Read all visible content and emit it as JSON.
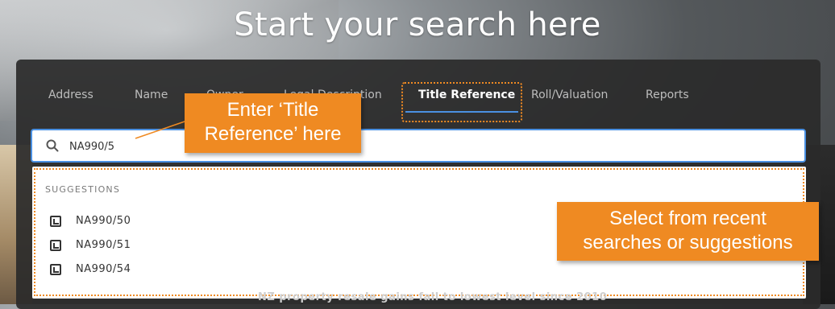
{
  "headline": "Start your search here",
  "tabs": [
    {
      "label": "Address"
    },
    {
      "label": "Name"
    },
    {
      "label": "Owner"
    },
    {
      "label": "Legal Description"
    },
    {
      "label": "Title Reference",
      "active": true
    },
    {
      "label": "Roll/Valuation"
    },
    {
      "label": "Reports"
    }
  ],
  "search": {
    "value": "NA990/5",
    "icon": "search-icon"
  },
  "suggestions": {
    "title": "SUGGESTIONS",
    "items": [
      {
        "label": "NA990/50",
        "icon": "title-icon"
      },
      {
        "label": "NA990/51",
        "icon": "title-icon"
      },
      {
        "label": "NA990/54",
        "icon": "title-icon"
      }
    ]
  },
  "callouts": {
    "enter_title_ref_line1": "Enter ‘Title",
    "enter_title_ref_line2": "Reference’ here",
    "select_line1": "Select from recent",
    "select_line2": "searches or suggestions"
  },
  "background_text": "NZ property resale gains fall to lowest level since 2010",
  "colors": {
    "accent_orange": "#ef8a22",
    "accent_blue": "#4a90e2",
    "panel": "#2a2a2a"
  }
}
